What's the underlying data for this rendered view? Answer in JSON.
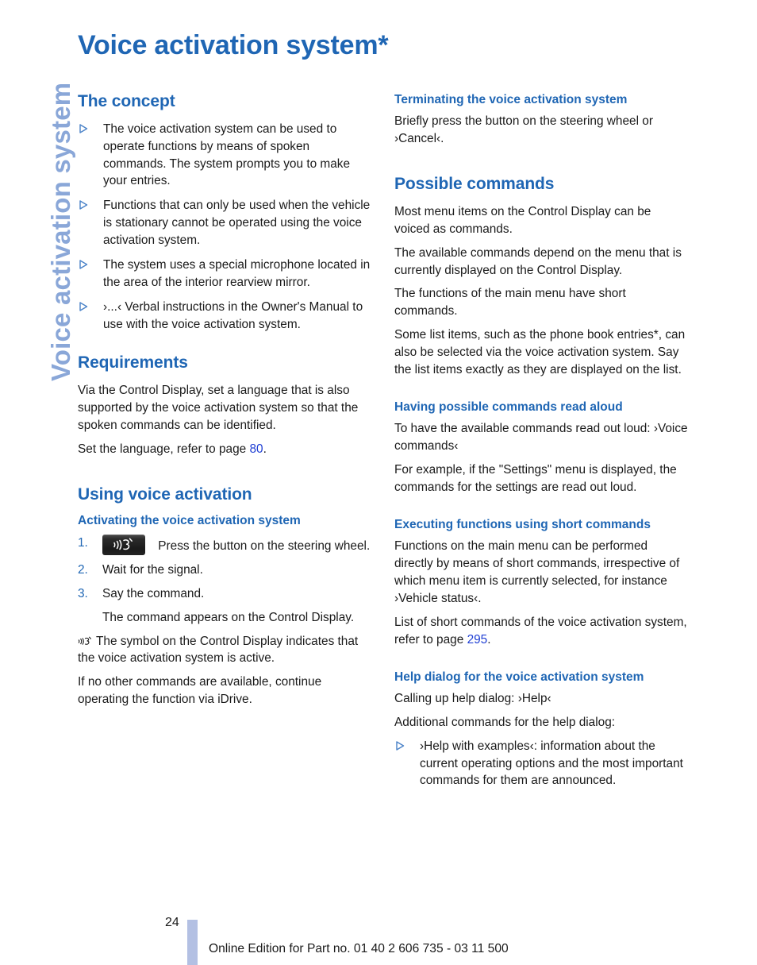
{
  "running_head": "Voice activation system",
  "page_title": "Voice activation system*",
  "colors": {
    "heading_blue": "#1f66b4",
    "running_head_blue": "#8aa7d8",
    "page_reference_blue": "#1f3fd4",
    "footer_bar_blue": "#b3c0e3",
    "body_text": "#1a1a1a"
  },
  "left_column": {
    "concept": {
      "heading": "The concept",
      "bullets": [
        "The voice activation system can be used to operate functions by means of spoken commands. The system prompts you to make your entries.",
        "Functions that can only be used when the vehicle is stationary cannot be operated using the voice activation system.",
        "The system uses a special microphone located in the area of the interior rearview mirror.",
        "›...‹ Verbal instructions in the Owner's Manual to use with the voice activation system."
      ]
    },
    "requirements": {
      "heading": "Requirements",
      "paragraph": "Via the Control Display, set a language that is also supported by the voice activation system so that the spoken commands can be identified.",
      "page_ref_lead": "Set the language, refer to page ",
      "page_ref_number": "80",
      "page_ref_tail": "."
    },
    "using": {
      "heading": "Using voice activation",
      "subheading": "Activating the voice activation system",
      "steps": [
        {
          "number": "1.",
          "icon": "voice-button-icon",
          "text": "Press the button on the steering wheel."
        },
        {
          "number": "2.",
          "icon": "",
          "text": "Wait for the signal."
        },
        {
          "number": "3.",
          "icon": "",
          "text": "Say the command."
        }
      ],
      "step3_note": "The command appears on the Control Display.",
      "symbol_note_icon": "voice-active-symbol-icon",
      "symbol_note": "The symbol on the Control Display indicates that the voice activation system is active.",
      "closing_note": "If no other commands are available, continue operating the function via iDrive."
    }
  },
  "right_column": {
    "terminating": {
      "heading": "Terminating the voice activation system",
      "paragraph": "Briefly press the button on the steering wheel or ›Cancel‹."
    },
    "possible_commands": {
      "heading": "Possible commands",
      "paragraphs": [
        "Most menu items on the Control Display can be voiced as commands.",
        "The available commands depend on the menu that is currently displayed on the Control Display.",
        "The functions of the main menu have short commands.",
        "Some list items, such as the phone book entries*, can also be selected via the voice activation system. Say the list items exactly as they are displayed on the list."
      ]
    },
    "read_aloud": {
      "heading": "Having possible commands read aloud",
      "paragraphs": [
        "To have the available commands read out loud: ›Voice commands‹",
        "For example, if the \"Settings\" menu is displayed, the commands for the settings are read out loud."
      ]
    },
    "short_commands": {
      "heading": "Executing functions using short commands",
      "paragraph": "Functions on the main menu can be performed directly by means of short commands, irrespective of which menu item is currently selected, for instance ›Vehicle status‹.",
      "page_ref_lead": "List of short commands of the voice activation system, refer to page ",
      "page_ref_number": "295",
      "page_ref_tail": "."
    },
    "help_dialog": {
      "heading": "Help dialog for the voice activation system",
      "paragraphs": [
        "Calling up help dialog: ›Help‹",
        "Additional commands for the help dialog:"
      ],
      "bullets": [
        "›Help with examples‹: information about the current operating options and the most important commands for them are announced."
      ]
    }
  },
  "footer": {
    "page_number": "24",
    "note": "Online Edition for Part no. 01 40 2 606 735 - 03 11 500"
  }
}
